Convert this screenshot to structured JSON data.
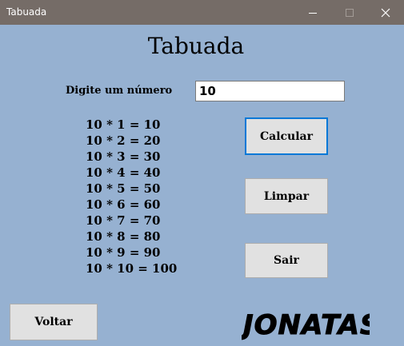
{
  "window": {
    "title": "Tabuada",
    "controls": [
      "minimize-icon",
      "maximize-icon",
      "close-icon"
    ]
  },
  "form": {
    "heading": "Tabuada",
    "prompt_label": "Digite um número",
    "number_value": "10"
  },
  "results": [
    "10 * 1 = 10",
    "10 * 2 = 20",
    "10 * 3 = 30",
    "10 * 4 = 40",
    "10 * 5 = 50",
    "10 * 6 = 60",
    "10 * 7 = 70",
    "10 * 8 = 80",
    "10 * 9 = 90",
    "10 * 10 = 100"
  ],
  "buttons": {
    "calcular": "Calcular",
    "limpar": "Limpar",
    "sair": "Sair",
    "voltar": "Voltar"
  },
  "signature": "JONATAS S",
  "colors": {
    "background": "#96b1d1",
    "titlebar": "#756c67",
    "button": "#e1e1e1",
    "focus_border": "#0078d7"
  }
}
